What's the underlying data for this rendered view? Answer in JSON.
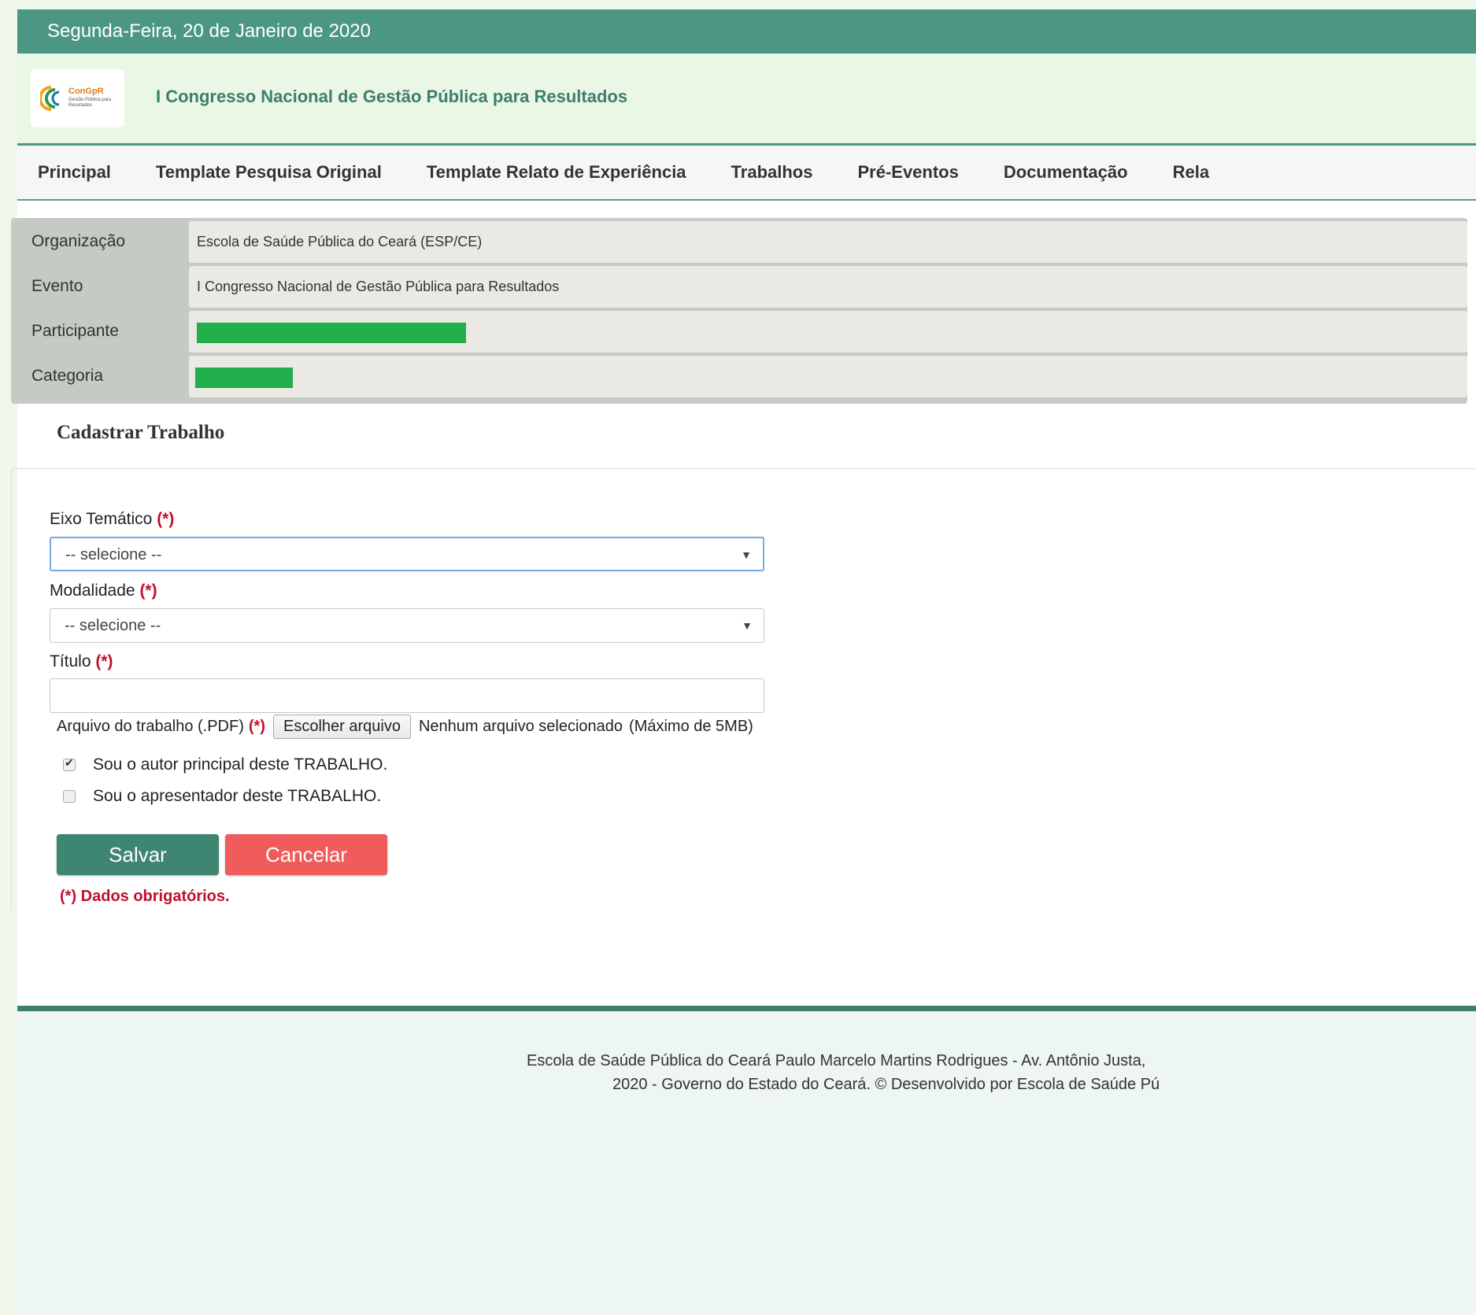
{
  "topbar": {
    "date": "Segunda-Feira, 20 de Janeiro de 2020"
  },
  "banner": {
    "logo_brand_a": "ConG",
    "logo_brand_b": "pR",
    "logo_subtitle": "Gestão Pública para Resultados",
    "title": "I Congresso Nacional de Gestão Pública para Resultados"
  },
  "nav": {
    "items": [
      "Principal",
      "Template Pesquisa Original",
      "Template Relato de Experiência",
      "Trabalhos",
      "Pré-Eventos",
      "Documentação",
      "Rela"
    ]
  },
  "info": {
    "organizacao_label": "Organização",
    "organizacao_value": "Escola de Saúde Pública do Ceará (ESP/CE)",
    "evento_label": "Evento",
    "evento_value": "I Congresso Nacional de Gestão Pública para Resultados",
    "participante_label": "Participante",
    "categoria_label": "Categoria"
  },
  "section_title": "Cadastrar Trabalho",
  "form": {
    "eixo_label": "Eixo Temático",
    "required_marker": "(*)",
    "eixo_selected": "-- selecione --",
    "modalidade_label": "Modalidade",
    "modalidade_selected": "-- selecione --",
    "titulo_label": "Título",
    "titulo_value": "",
    "arquivo_label": "Arquivo do trabalho (.PDF)",
    "file_button": "Escolher arquivo",
    "file_status": "Nenhum arquivo selecionado",
    "file_limit": "(Máximo de 5MB)",
    "check_autor": "Sou o autor principal deste TRABALHO.",
    "check_autor_checked": true,
    "check_apresentador": "Sou o apresentador deste TRABALHO.",
    "check_apresentador_checked": false,
    "save_button": "Salvar",
    "cancel_button": "Cancelar",
    "required_note": "(*) Dados obrigatórios."
  },
  "colors": {
    "primary": "#4b9784",
    "save": "#3f8672",
    "cancel": "#f05c5c",
    "required": "#c0102a",
    "redacted": "#22ae4b"
  },
  "footer": {
    "line1": "Escola de Saúde Pública do Ceará Paulo Marcelo Martins Rodrigues - Av. Antônio Justa,",
    "line2": "2020 - Governo do Estado do Ceará. © Desenvolvido por Escola de Saúde Pú"
  }
}
